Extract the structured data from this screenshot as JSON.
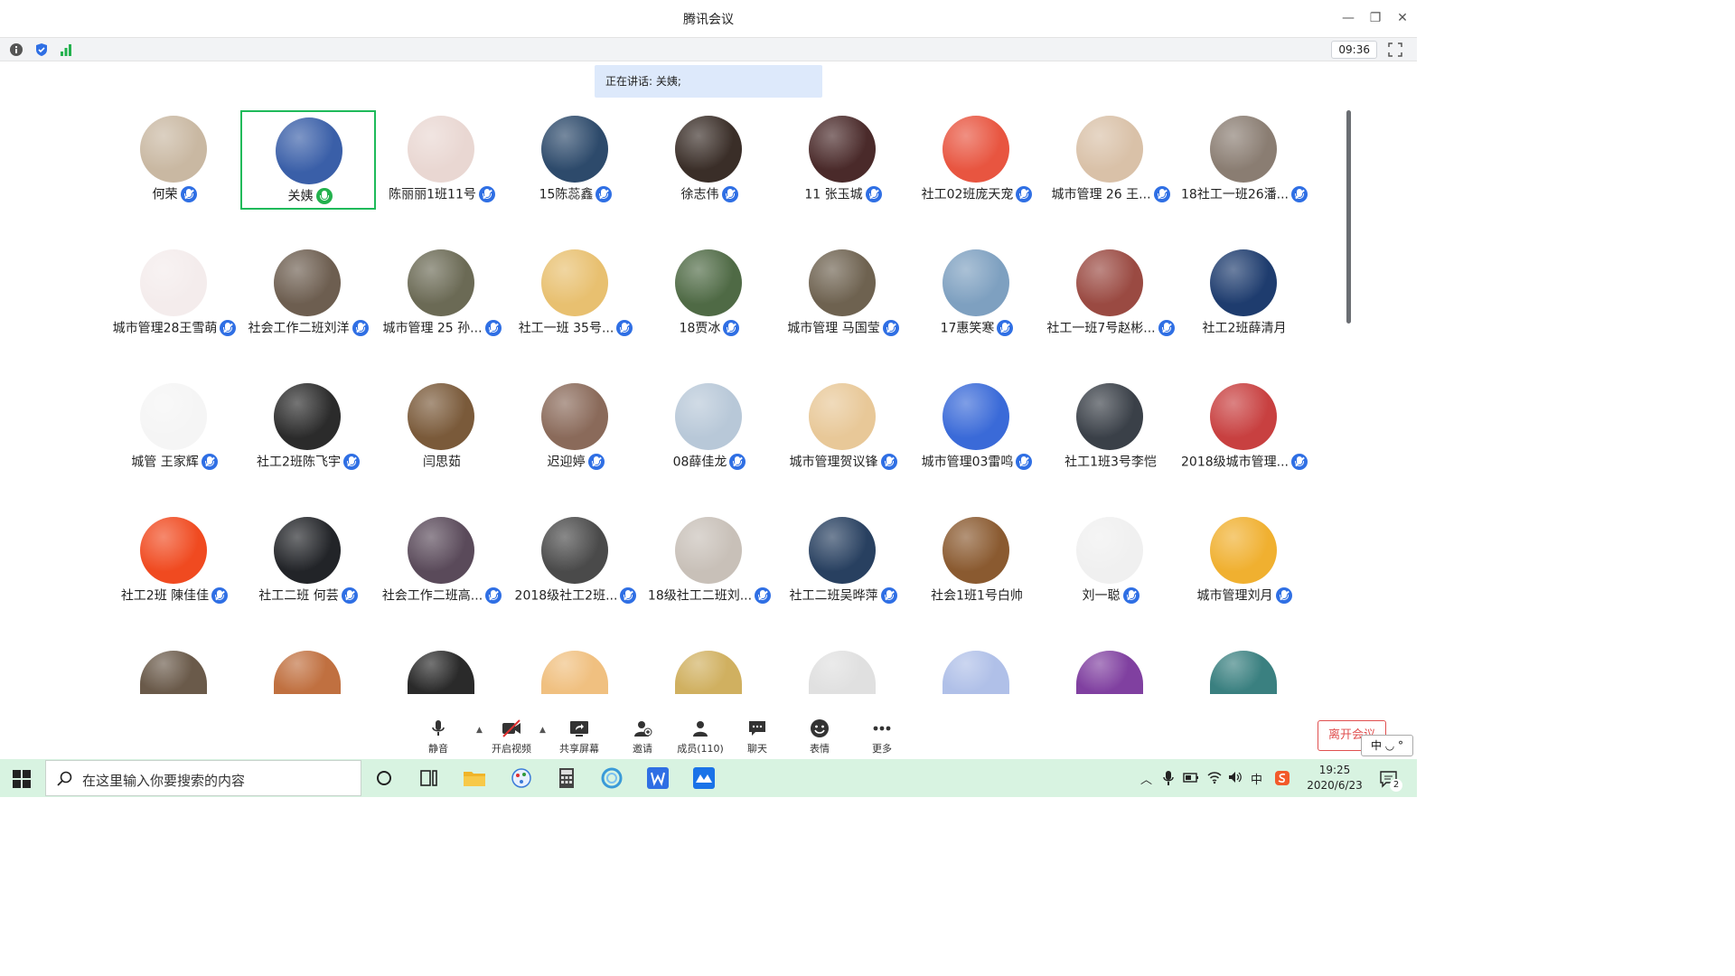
{
  "window": {
    "title": "腾讯会议",
    "minimize": "—",
    "restore": "❐",
    "close": "✕"
  },
  "toolbar": {
    "timer": "09:36"
  },
  "speaking_banner": "正在讲话: 关姨;",
  "participants": [
    {
      "name": "何荣",
      "bg": "#c9b8a2",
      "mic": "muted"
    },
    {
      "name": "关姨",
      "bg": "#3a5fa8",
      "mic": "speaking",
      "active": true
    },
    {
      "name": "陈丽丽1班11号",
      "bg": "#e9d7d2",
      "mic": "muted"
    },
    {
      "name": "15陈蕊鑫",
      "bg": "#2d4a6b",
      "mic": "muted"
    },
    {
      "name": "徐志伟",
      "bg": "#3a2e28",
      "mic": "muted"
    },
    {
      "name": "11  张玉城",
      "bg": "#4a2a2a",
      "mic": "muted"
    },
    {
      "name": "社工02班庞天宠",
      "bg": "#e85540",
      "mic": "muted"
    },
    {
      "name": "城市管理 26 王...",
      "bg": "#d9c1a8",
      "mic": "muted"
    },
    {
      "name": "18社工一班26潘...",
      "bg": "#8a7d72",
      "mic": "muted"
    },
    {
      "name": "城市管理28王雪萌",
      "bg": "#f4ecec",
      "mic": "muted"
    },
    {
      "name": "社会工作二班刘洋",
      "bg": "#6d5e50",
      "mic": "muted"
    },
    {
      "name": "城市管理 25 孙...",
      "bg": "#6b6a55",
      "mic": "muted"
    },
    {
      "name": "社工一班 35号...",
      "bg": "#e8c070",
      "mic": "muted"
    },
    {
      "name": "18贾冰",
      "bg": "#4f6a45",
      "mic": "muted"
    },
    {
      "name": "城市管理 马国莹",
      "bg": "#6e6250",
      "mic": "muted"
    },
    {
      "name": "17惠笑寒",
      "bg": "#7ea0c0",
      "mic": "muted"
    },
    {
      "name": "社工一班7号赵彬...",
      "bg": "#9a4a42",
      "mic": "muted"
    },
    {
      "name": "社工2班薛清月",
      "bg": "#1e3c6e",
      "mic": "none"
    },
    {
      "name": "城管 王家辉",
      "bg": "#f5f5f5",
      "mic": "muted"
    },
    {
      "name": "社工2班陈飞宇",
      "bg": "#2b2b2b",
      "mic": "muted"
    },
    {
      "name": "闫思茹",
      "bg": "#7a5a3a",
      "mic": "none"
    },
    {
      "name": "迟迎婷",
      "bg": "#8a6a5a",
      "mic": "muted"
    },
    {
      "name": "08薛佳龙",
      "bg": "#b8c8d8",
      "mic": "muted"
    },
    {
      "name": "城市管理贺议锋",
      "bg": "#e8c898",
      "mic": "muted"
    },
    {
      "name": "城市管理03雷鸣",
      "bg": "#3a6ad8",
      "mic": "muted"
    },
    {
      "name": "社工1班3号李恺",
      "bg": "#3a4048",
      "mic": "none"
    },
    {
      "name": "2018级城市管理...",
      "bg": "#c84040",
      "mic": "muted"
    },
    {
      "name": "社工2班 陳佳佳",
      "bg": "#f04a20",
      "mic": "muted"
    },
    {
      "name": "社工二班 何芸",
      "bg": "#222428",
      "mic": "muted"
    },
    {
      "name": "社会工作二班高...",
      "bg": "#5a4a5a",
      "mic": "muted"
    },
    {
      "name": "2018级社工2班...",
      "bg": "#4a4a4a",
      "mic": "muted"
    },
    {
      "name": "18级社工二班刘...",
      "bg": "#c8c0b8",
      "mic": "muted"
    },
    {
      "name": "社工二班吴晔萍",
      "bg": "#284060",
      "mic": "muted"
    },
    {
      "name": "社会1班1号白帅",
      "bg": "#8a5a30",
      "mic": "none"
    },
    {
      "name": "刘一聪",
      "bg": "#f0f0f0",
      "mic": "muted"
    },
    {
      "name": "城市管理刘月",
      "bg": "#f0b030",
      "mic": "muted"
    },
    {
      "name": "",
      "bg": "#6a5a4a",
      "mic": "none"
    },
    {
      "name": "",
      "bg": "#c07040",
      "mic": "none"
    },
    {
      "name": "",
      "bg": "#2a2a2a",
      "mic": "none"
    },
    {
      "name": "",
      "bg": "#f0c080",
      "mic": "none"
    },
    {
      "name": "",
      "bg": "#d0b060",
      "mic": "none"
    },
    {
      "name": "",
      "bg": "#e0e0e0",
      "mic": "none"
    },
    {
      "name": "",
      "bg": "#b0c0e8",
      "mic": "none"
    },
    {
      "name": "",
      "bg": "#8040a0",
      "mic": "none"
    },
    {
      "name": "",
      "bg": "#3a8080",
      "mic": "none"
    }
  ],
  "controls": {
    "mute": "静音",
    "video": "开启视频",
    "share": "共享屏幕",
    "invite": "邀请",
    "members": "成员(110)",
    "chat": "聊天",
    "emoji": "表情",
    "more": "更多",
    "leave": "离开会议"
  },
  "ime": "中 ◡ °",
  "taskbar": {
    "search_placeholder": "在这里输入你要搜索的内容",
    "time": "19:25",
    "date": "2020/6/23",
    "notifications": "2",
    "tray_lang": "中"
  }
}
